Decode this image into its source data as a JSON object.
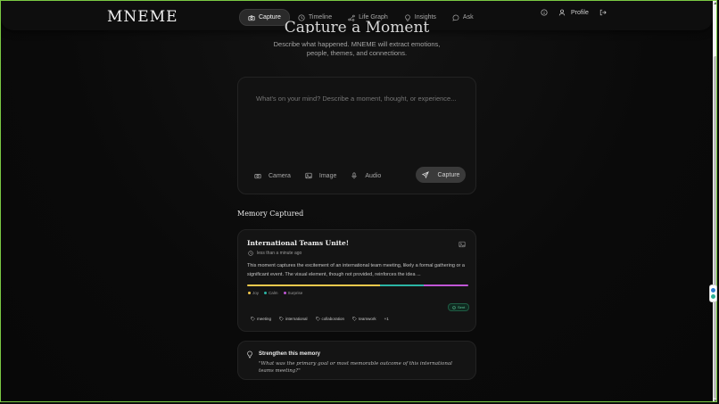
{
  "app": {
    "logo": "MNEME"
  },
  "nav": {
    "items": [
      {
        "label": "Capture",
        "icon": "camera-icon",
        "active": true
      },
      {
        "label": "Timeline",
        "icon": "clock-icon",
        "active": false
      },
      {
        "label": "Life Graph",
        "icon": "graph-icon",
        "active": false
      },
      {
        "label": "Insights",
        "icon": "lightbulb-icon",
        "active": false
      },
      {
        "label": "Ask",
        "icon": "chat-icon",
        "active": false
      }
    ],
    "profile_label": "Profile"
  },
  "hero": {
    "title": "Capture a Moment",
    "subtitle_line1": "Describe what happened. MNEME will extract emotions,",
    "subtitle_line2": "people, themes, and connections."
  },
  "capture": {
    "placeholder": "What's on your mind? Describe a moment, thought, or experience...",
    "tools": {
      "camera": "Camera",
      "image": "Image",
      "audio": "Audio"
    },
    "submit_label": "Capture"
  },
  "memory_section": {
    "title": "Memory Captured"
  },
  "memory": {
    "title": "International Teams Unite!",
    "time": "less than a minute ago",
    "summary": "This moment captures the excitement of an international team meeting, likely a formal gathering or a significant event. The visual element, though not provided, reinforces the idea ...",
    "emotion_bar": [
      {
        "name": "Joy",
        "fraction": 0.6,
        "color": "#f2c94c"
      },
      {
        "name": "Calm",
        "fraction": 0.2,
        "color": "#2bb5a5"
      },
      {
        "name": "Surprise",
        "fraction": 0.2,
        "color": "#c056d6"
      }
    ],
    "legend": [
      {
        "label": "Joy",
        "color": "#f2c94c"
      },
      {
        "label": "Calm",
        "color": "#2bb5a5"
      },
      {
        "label": "Surprise",
        "color": "#c056d6"
      }
    ],
    "badge": "Sent",
    "tags": [
      "meeting",
      "international",
      "collaboration",
      "teamwork"
    ],
    "more_tags": "+1"
  },
  "strengthen": {
    "title": "Strengthen this memory",
    "question": "\"What was the primary goal or most memorable outcome of this international teams meeting?\""
  }
}
